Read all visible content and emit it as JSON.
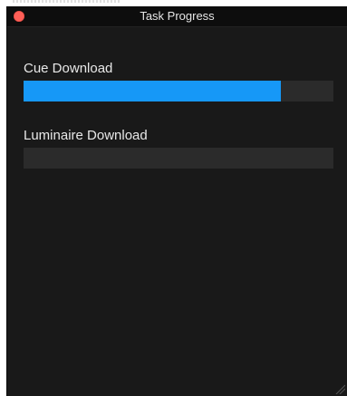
{
  "window": {
    "title": "Task Progress"
  },
  "tasks": [
    {
      "label": "Cue Download",
      "progress": 0.83
    },
    {
      "label": "Luminaire Download",
      "progress": 0.0
    }
  ],
  "colors": {
    "progress_fill": "#1698f7",
    "progress_track": "#2b2b2b",
    "close_button": "#ff5f57",
    "background": "#191919"
  },
  "icons": {
    "close": "close-icon",
    "resize": "resize-grip-icon"
  }
}
